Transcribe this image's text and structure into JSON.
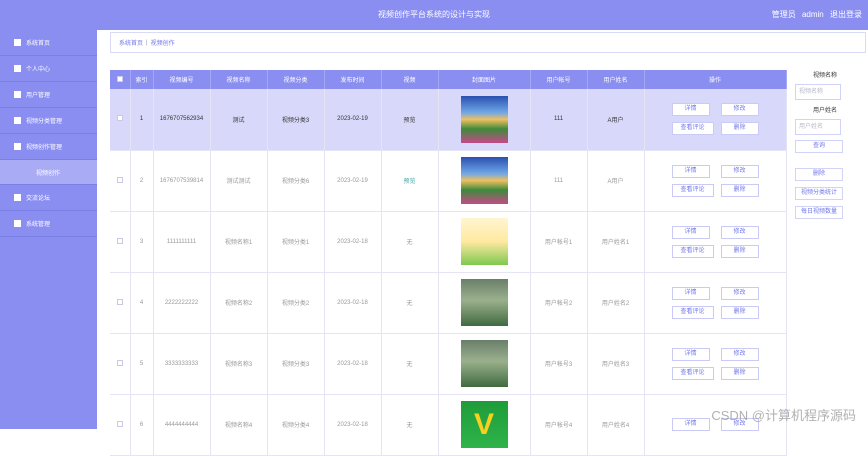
{
  "header": {
    "title": "视频创作平台系统的设计与实现",
    "user_role": "管理员",
    "user_name": "admin",
    "logout": "退出登录"
  },
  "sidebar": {
    "items": [
      {
        "label": "系统首页",
        "icon": "home-icon"
      },
      {
        "label": "个人中心",
        "icon": "person-icon"
      },
      {
        "label": "用户管理",
        "icon": "table-icon"
      },
      {
        "label": "视频分类管理",
        "icon": "folder-icon"
      },
      {
        "label": "视频创作管理",
        "icon": "list-icon"
      },
      {
        "label": "视频创作",
        "icon": ""
      },
      {
        "label": "交流论坛",
        "icon": "grid-icon"
      },
      {
        "label": "系统管理",
        "icon": "book-icon"
      }
    ]
  },
  "breadcrumb": {
    "home": "系统首页",
    "current": "视频创作"
  },
  "table": {
    "headers": [
      "索引",
      "视频编号",
      "视频名称",
      "视频分类",
      "发布时间",
      "视频",
      "封面图片",
      "用户帐号",
      "用户姓名",
      "操作"
    ],
    "rows": [
      {
        "index": "1",
        "code": "1676707562934",
        "name": "测试",
        "category": "视频分类3",
        "date": "2023-02-19",
        "video": "预览",
        "account": "111",
        "username": "A用户"
      },
      {
        "index": "2",
        "code": "1676707539814",
        "name": "测试测试",
        "category": "视频分类6",
        "date": "2023-02-19",
        "video": "预览",
        "account": "111",
        "username": "A用户"
      },
      {
        "index": "3",
        "code": "1111111111",
        "name": "视频名称1",
        "category": "视频分类1",
        "date": "2023-02-18",
        "video": "无",
        "account": "用户帐号1",
        "username": "用户姓名1"
      },
      {
        "index": "4",
        "code": "2222222222",
        "name": "视频名称2",
        "category": "视频分类2",
        "date": "2023-02-18",
        "video": "无",
        "account": "用户帐号2",
        "username": "用户姓名2"
      },
      {
        "index": "5",
        "code": "3333333333",
        "name": "视频名称3",
        "category": "视频分类3",
        "date": "2023-02-18",
        "video": "无",
        "account": "用户帐号3",
        "username": "用户姓名3"
      },
      {
        "index": "6",
        "code": "4444444444",
        "name": "视频名称4",
        "category": "视频分类4",
        "date": "2023-02-18",
        "video": "无",
        "account": "用户帐号4",
        "username": "用户姓名4"
      }
    ],
    "ops": {
      "detail": "详情",
      "edit": "修改",
      "view_comments": "查看评论",
      "delete": "删除"
    }
  },
  "panel": {
    "name_label": "视频名称",
    "name_placeholder": "视频名称",
    "user_label": "用户姓名",
    "user_placeholder": "用户姓名",
    "search": "查询",
    "delete": "删除",
    "stats1": "视频分类统计",
    "stats2": "每日视频数量"
  },
  "watermark": "CSDN @计算机程序源码"
}
